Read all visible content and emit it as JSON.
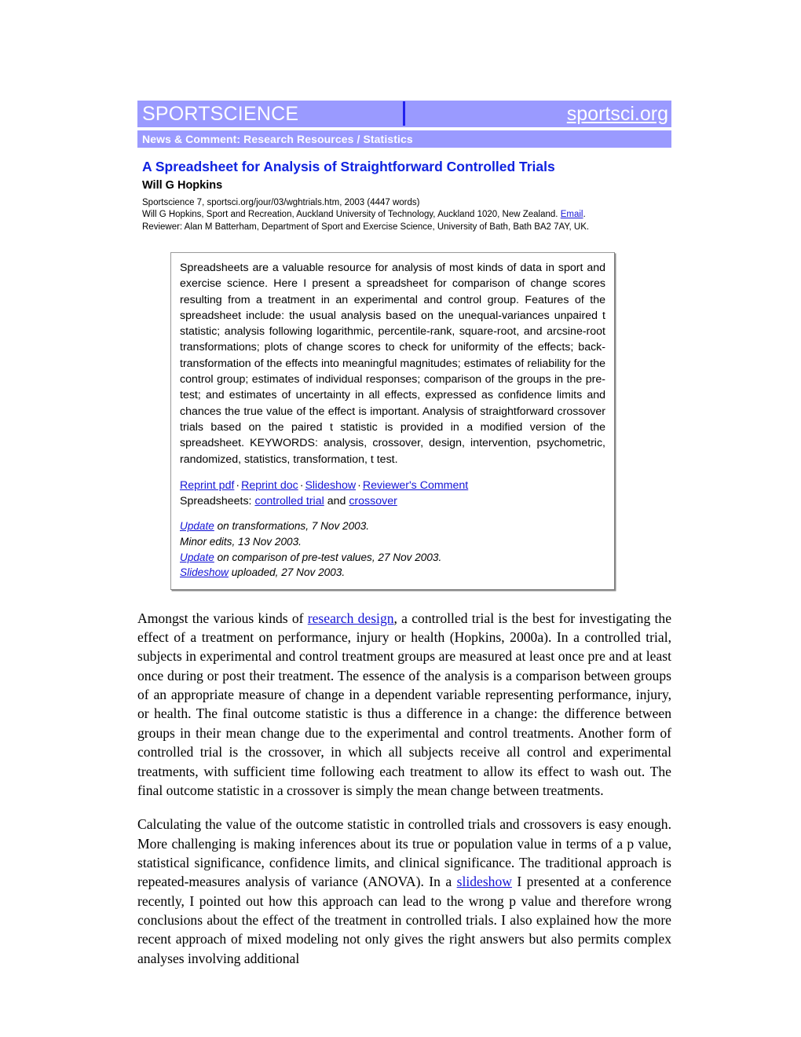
{
  "masthead": {
    "brand": "SPORTSCIENCE",
    "site_link": "sportsci.org",
    "section": "News & Comment: Research Resources / Statistics",
    "bar_color": "#9a9aff",
    "divider_color": "#2222ee",
    "text_color": "#ffffff"
  },
  "article": {
    "title": "A Spreadsheet for Analysis of Straightforward Controlled Trials",
    "title_color": "#0f22e0",
    "author": "Will G Hopkins",
    "citation": "Sportscience 7, sportsci.org/jour/03/wghtrials.htm, 2003 (4447 words)",
    "affiliation_pre": "Will G Hopkins, Sport and Recreation, Auckland University of Technology, Auckland 1020, New Zealand. ",
    "affiliation_email_label": "Email",
    "affiliation_post": ".",
    "reviewer": "Reviewer: Alan M Batterham, Department of Sport and Exercise Science, University of Bath, Bath BA2 7AY, UK."
  },
  "abstract": {
    "text": "Spreadsheets are a valuable resource for analysis of most kinds of data in sport and exercise science.  Here I present a spreadsheet for comparison of change scores resulting from a treatment in an experimental and control group. Features of the spreadsheet include: the usual analysis based on the unequal-variances unpaired t statistic; analysis following logarithmic, percentile-rank, square-root, and arcsine-root transformations; plots of change scores to check for uniformity of the effects; back-transformation of the effects into meaningful magnitudes; estimates of reliability for the control group; estimates of individual responses; comparison of the groups in the pre-test; and estimates of uncertainty in all effects, expressed as confidence limits and chances the true value of the effect is important.  Analysis of straightforward crossover trials based on the paired t statistic is provided in a modified version of the spreadsheet. KEYWORDS: analysis, crossover, design, intervention, psychometric, randomized, statistics, transformation, t test.",
    "resource_links": [
      "Reprint pdf",
      "Reprint doc",
      "Slideshow",
      "Reviewer's Comment"
    ],
    "link_separator": "·",
    "spreadsheets_label": "Spreadsheets: ",
    "spreadsheets_link_1": "controlled trial",
    "spreadsheets_conjunction": " and ",
    "spreadsheets_link_2": "crossover",
    "updates": [
      {
        "link": "Update",
        "rest": " on transformations, 7 Nov 2003."
      },
      {
        "link": "",
        "rest": "Minor edits, 13 Nov 2003."
      },
      {
        "link": "Update",
        "rest": " on comparison of pre-test values, 27 Nov 2003."
      },
      {
        "link": "Slideshow",
        "rest": " uploaded, 27 Nov 2003."
      }
    ]
  },
  "body": {
    "paragraph_1_a": "Amongst the various kinds of ",
    "paragraph_1_link": "research design",
    "paragraph_1_b": ", a controlled trial is the best for investigating the effect of a treatment on performance, injury or health (Hopkins, 2000a). In a controlled trial, subjects in experimental and control treatment groups are measured at least once pre and at least once during or post their treatment.  The essence of the analysis is a comparison between groups of an appropriate measure of change in a dependent variable representing performance, injury, or health. The final outcome statistic is thus a difference in a change: the difference between groups in their mean change due to the experimental and control treatments.  Another form of controlled trial is the crossover, in which all subjects receive all control and experimental treatments, with sufficient time following each treatment to allow its effect to wash out. The final outcome statistic in a crossover is simply the mean change between treatments.",
    "paragraph_2_a": "Calculating the value of the outcome statistic in controlled trials and crossovers is easy enough.  More challenging is making inferences about its true or population value in terms of a p value, statistical significance, confidence limits, and clinical significance. The traditional approach is repeated-measures analysis of variance (ANOVA).  In a ",
    "paragraph_2_link": "slideshow",
    "paragraph_2_b": " I presented at a conference recently, I pointed out how this approach can lead to the wrong p value and therefore wrong conclusions about the effect of the treatment in controlled trials.  I also explained how the more recent approach of mixed modeling not only gives the right answers but also permits complex analyses involving additional"
  }
}
